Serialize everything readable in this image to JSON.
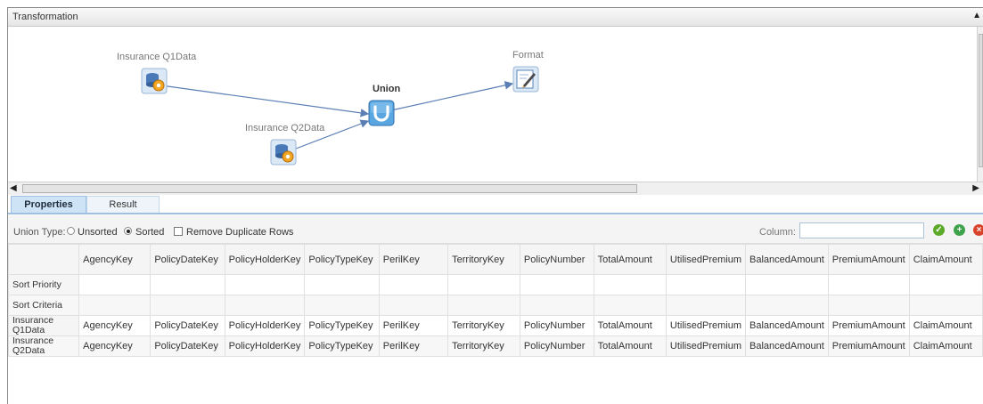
{
  "panel": {
    "title": "Transformation",
    "collapse_icon": "chevron-up-icon"
  },
  "canvas": {
    "nodes": [
      {
        "label": "Insurance Q1Data",
        "icon": "datasource-gear-icon"
      },
      {
        "label": "Insurance Q2Data",
        "icon": "datasource-gear-icon"
      },
      {
        "label": "Union",
        "icon": "union-icon"
      },
      {
        "label": "Format",
        "icon": "format-edit-icon"
      }
    ]
  },
  "tabs": [
    {
      "label": "Properties",
      "active": true
    },
    {
      "label": "Result",
      "active": false
    }
  ],
  "options": {
    "union_type_label": "Union Type:",
    "unsorted_label": "Unsorted",
    "sorted_label": "Sorted",
    "selected": "Sorted",
    "remove_duplicates_label": "Remove Duplicate Rows",
    "remove_duplicates_checked": false,
    "column_label": "Column:",
    "column_value": ""
  },
  "grid": {
    "columns": [
      "AgencyKey",
      "PolicyDateKey",
      "PolicyHolderKey",
      "PolicyTypeKey",
      "PerilKey",
      "TerritoryKey",
      "PolicyNumber",
      "TotalAmount",
      "UtilisedPremium",
      "BalancedAmount",
      "PremiumAmount",
      "ClaimAmount"
    ],
    "rows": [
      {
        "header": "Sort Priority",
        "cells": [
          "",
          "",
          "",
          "",
          "",
          "",
          "",
          "",
          "",
          "",
          "",
          ""
        ]
      },
      {
        "header": "Sort Criteria",
        "cells": [
          "",
          "",
          "",
          "",
          "",
          "",
          "",
          "",
          "",
          "",
          "",
          ""
        ]
      },
      {
        "header": "Insurance Q1Data",
        "cells": [
          "AgencyKey",
          "PolicyDateKey",
          "PolicyHolderKey",
          "PolicyTypeKey",
          "PerilKey",
          "TerritoryKey",
          "PolicyNumber",
          "TotalAmount",
          "UtilisedPremium",
          "BalancedAmount",
          "PremiumAmount",
          "ClaimAmount"
        ]
      },
      {
        "header": "Insurance Q2Data",
        "cells": [
          "AgencyKey",
          "PolicyDateKey",
          "PolicyHolderKey",
          "PolicyTypeKey",
          "PerilKey",
          "TerritoryKey",
          "PolicyNumber",
          "TotalAmount",
          "UtilisedPremium",
          "BalancedAmount",
          "PremiumAmount",
          "ClaimAmount"
        ]
      }
    ]
  },
  "colors": {
    "accent": "#9dc0e3",
    "ok": "#5daa2b",
    "add": "#3ea34b",
    "delete": "#d9432c",
    "link_line": "#5b7fb5"
  }
}
